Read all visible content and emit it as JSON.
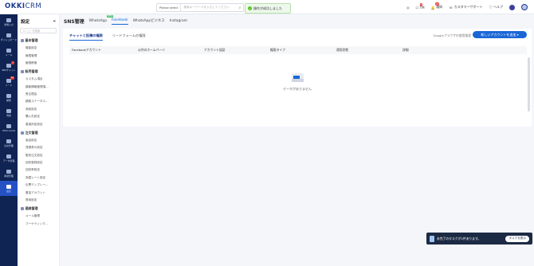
{
  "app": {
    "logo_main": "OKKI",
    "logo_sub": "CRM"
  },
  "search": {
    "select_label": "Please select",
    "placeholder": "検索キーワードを入力してください"
  },
  "toast": {
    "message": "操作が成功しました"
  },
  "topbar": {
    "tm_label": "TM",
    "tm_badge": "2",
    "notice_label": "通知",
    "notice_badge": "19",
    "support_label": "カスタマーサポート",
    "help_label": "ヘルプ"
  },
  "nav": [
    {
      "label": "新規入力",
      "active": false
    },
    {
      "label": "ダッシュボード",
      "active": false
    },
    {
      "label": "メール",
      "active": false
    },
    {
      "label": "SNSチャット",
      "active": false,
      "badge": "1"
    },
    {
      "label": "リード",
      "active": false,
      "badge": "24"
    },
    {
      "label": "顧客",
      "active": false
    },
    {
      "label": "商談",
      "active": false
    },
    {
      "label": "OKKI Leads",
      "active": false
    },
    {
      "label": "注文管理",
      "active": false
    },
    {
      "label": "データ管理",
      "active": false
    },
    {
      "label": "承認管理",
      "active": false
    },
    {
      "label": "設定",
      "active": true
    }
  ],
  "sidebar": {
    "title": "設定",
    "search_placeholder": "メニューを検索",
    "groups": [
      {
        "title": "基本管理",
        "items": [
          "機能設定",
          "権限管理",
          "権限移管"
        ]
      },
      {
        "title": "販売管理",
        "items": [
          "カスタム項目",
          "顧客情報管理項...",
          "受注理由",
          "顧客ステータス...",
          "商談設定",
          "購入先設定",
          "重複判定設定"
        ]
      },
      {
        "title": "注文管理",
        "items": [
          "製品設定",
          "見積書の設定",
          "販売注文設定",
          "回収登録設定",
          "回収率設定",
          "為替レート設定",
          "伝票テンプレー...",
          "着金アカウント",
          "費用設定"
        ]
      },
      {
        "title": "連絡管理",
        "items": [
          "メール管理",
          "マーケティング..."
        ]
      }
    ]
  },
  "main": {
    "title": "SNS管理",
    "tabs": [
      {
        "label": "WhatsApp",
        "new": "NEW",
        "active": false
      },
      {
        "label": "Facebook",
        "active": true
      },
      {
        "label": "WhatsAppビジネス",
        "active": false
      },
      {
        "label": "Instagram",
        "active": false
      }
    ],
    "subtabs": [
      {
        "label": "チャットと投稿の権限",
        "active": true
      },
      {
        "label": "リードフォームの権限",
        "active": false
      }
    ],
    "help_link": "Googleブラウザの使用推奨",
    "add_button": "新しいアカウントを追加",
    "table_headers": [
      "Facebookアカウント",
      "公共のホームページ",
      "アカウント認証",
      "権限タイプ",
      "運用状態",
      "詳細"
    ],
    "empty_message": "データがありません"
  },
  "taskbar": {
    "message": "未完了のタスクが2件あります。",
    "button": "タスクを表示"
  }
}
